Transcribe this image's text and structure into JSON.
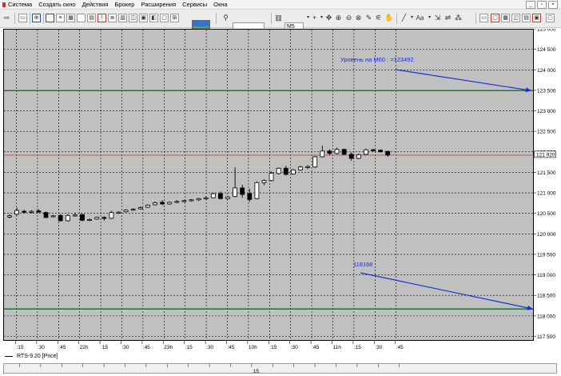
{
  "menu": {
    "items": [
      "Система",
      "Создать окно",
      "Действия",
      "Брокер",
      "Расширения",
      "Сервисы",
      "Окна"
    ]
  },
  "toolbar": {
    "timeframe": "M5",
    "icons": [
      "new-chart-icon",
      "open-icon",
      "save-icon",
      "print-icon",
      "logo-icon",
      "search-icon",
      "bar-chart-icon",
      "crosshair-icon",
      "zoom-in-icon",
      "zoom-out-icon",
      "pencil-icon",
      "hand-icon",
      "line-tool-icon",
      "text-tool-icon",
      "fibonacci-icon",
      "layout-icon",
      "windows-icon"
    ]
  },
  "chart_data": {
    "type": "candlestick",
    "symbol_label": "RTS-9.20 [Price]",
    "colors": {
      "background": "#c0c0c0",
      "grid": "#000000",
      "level_lines": "#1a7a2c",
      "last_price_line": "#e04040",
      "annotations": "#1c2fd6",
      "bull_candle": "#ffffff",
      "bear_candle": "#000000"
    },
    "price_axis": {
      "ylim": [
        117500,
        125000
      ],
      "ticks": [
        "125 000",
        "124 500",
        "124 000",
        "123 500",
        "123 000",
        "122 500",
        "122 000",
        "121 500",
        "121 000",
        "120 500",
        "120 000",
        "119 500",
        "119 000",
        "118 500",
        "118 000",
        "117 500"
      ],
      "tick_values": [
        125000,
        124500,
        124000,
        123500,
        123000,
        122500,
        122000,
        121500,
        121000,
        120500,
        120000,
        119500,
        119000,
        118500,
        118000,
        117500
      ],
      "last_price_label": "121 920",
      "last_price": 121920
    },
    "time_axis": {
      "labels": [
        ":15",
        ":30",
        ":45",
        "22h",
        ":15",
        ":30",
        ":45",
        "23h",
        ":15",
        ":30",
        ":45",
        "10h",
        ":15",
        ":30",
        ":45",
        "11h",
        ":15",
        ":30",
        ":45"
      ],
      "date_marker": "15"
    },
    "horizontal_levels": [
      {
        "name": "level-123492",
        "price": 123492
      },
      {
        "name": "level-118168",
        "price": 118168
      }
    ],
    "annotations": [
      {
        "label": "Уровень на М60 : =123492",
        "price": 123492
      },
      {
        "label": "118168",
        "price": 118168
      }
    ],
    "candles": [
      {
        "o": 120410,
        "h": 120480,
        "l": 120380,
        "c": 120440
      },
      {
        "o": 120480,
        "h": 120640,
        "l": 120450,
        "c": 120570
      },
      {
        "o": 120550,
        "h": 120590,
        "l": 120510,
        "c": 120530
      },
      {
        "o": 120540,
        "h": 120580,
        "l": 120500,
        "c": 120550
      },
      {
        "o": 120560,
        "h": 120600,
        "l": 120520,
        "c": 120530
      },
      {
        "o": 120520,
        "h": 120540,
        "l": 120380,
        "c": 120400
      },
      {
        "o": 120420,
        "h": 120460,
        "l": 120400,
        "c": 120440
      },
      {
        "o": 120450,
        "h": 120480,
        "l": 120300,
        "c": 120320
      },
      {
        "o": 120320,
        "h": 120480,
        "l": 120300,
        "c": 120450
      },
      {
        "o": 120450,
        "h": 120520,
        "l": 120420,
        "c": 120460
      },
      {
        "o": 120470,
        "h": 120490,
        "l": 120310,
        "c": 120330
      },
      {
        "o": 120330,
        "h": 120380,
        "l": 120310,
        "c": 120350
      },
      {
        "o": 120360,
        "h": 120420,
        "l": 120340,
        "c": 120400
      },
      {
        "o": 120400,
        "h": 120430,
        "l": 120320,
        "c": 120380
      },
      {
        "o": 120380,
        "h": 120560,
        "l": 120360,
        "c": 120520
      },
      {
        "o": 120510,
        "h": 120550,
        "l": 120490,
        "c": 120530
      },
      {
        "o": 120540,
        "h": 120600,
        "l": 120520,
        "c": 120580
      },
      {
        "o": 120580,
        "h": 120630,
        "l": 120560,
        "c": 120600
      },
      {
        "o": 120610,
        "h": 120670,
        "l": 120590,
        "c": 120640
      },
      {
        "o": 120650,
        "h": 120720,
        "l": 120630,
        "c": 120700
      },
      {
        "o": 120710,
        "h": 120790,
        "l": 120690,
        "c": 120760
      },
      {
        "o": 120770,
        "h": 120820,
        "l": 120700,
        "c": 120730
      },
      {
        "o": 120730,
        "h": 120790,
        "l": 120710,
        "c": 120770
      },
      {
        "o": 120770,
        "h": 120820,
        "l": 120750,
        "c": 120790
      },
      {
        "o": 120790,
        "h": 120830,
        "l": 120770,
        "c": 120810
      },
      {
        "o": 120810,
        "h": 120850,
        "l": 120790,
        "c": 120830
      },
      {
        "o": 120830,
        "h": 120880,
        "l": 120800,
        "c": 120860
      },
      {
        "o": 120860,
        "h": 120920,
        "l": 120840,
        "c": 120880
      },
      {
        "o": 120880,
        "h": 121000,
        "l": 120860,
        "c": 120980
      },
      {
        "o": 120980,
        "h": 121030,
        "l": 120840,
        "c": 120860
      },
      {
        "o": 120860,
        "h": 120920,
        "l": 120840,
        "c": 120900
      },
      {
        "o": 120910,
        "h": 121620,
        "l": 120890,
        "c": 121120
      },
      {
        "o": 121120,
        "h": 121200,
        "l": 120880,
        "c": 120960
      },
      {
        "o": 120980,
        "h": 121100,
        "l": 120780,
        "c": 120840
      },
      {
        "o": 120860,
        "h": 121280,
        "l": 120840,
        "c": 121250
      },
      {
        "o": 121250,
        "h": 121330,
        "l": 121190,
        "c": 121300
      },
      {
        "o": 121300,
        "h": 121520,
        "l": 121280,
        "c": 121480
      },
      {
        "o": 121470,
        "h": 121620,
        "l": 121450,
        "c": 121600
      },
      {
        "o": 121600,
        "h": 121660,
        "l": 121420,
        "c": 121450
      },
      {
        "o": 121460,
        "h": 121580,
        "l": 121440,
        "c": 121560
      },
      {
        "o": 121560,
        "h": 121660,
        "l": 121540,
        "c": 121630
      },
      {
        "o": 121620,
        "h": 121680,
        "l": 121580,
        "c": 121640
      },
      {
        "o": 121630,
        "h": 121900,
        "l": 121610,
        "c": 121880
      },
      {
        "o": 121880,
        "h": 122150,
        "l": 121860,
        "c": 122020
      },
      {
        "o": 122020,
        "h": 122060,
        "l": 121920,
        "c": 121960
      },
      {
        "o": 121960,
        "h": 122100,
        "l": 121940,
        "c": 122060
      },
      {
        "o": 122060,
        "h": 122080,
        "l": 121920,
        "c": 121940
      },
      {
        "o": 121940,
        "h": 121990,
        "l": 121780,
        "c": 121840
      },
      {
        "o": 121840,
        "h": 121960,
        "l": 121820,
        "c": 121930
      },
      {
        "o": 121940,
        "h": 122080,
        "l": 121920,
        "c": 122050
      },
      {
        "o": 122050,
        "h": 122080,
        "l": 122010,
        "c": 122030
      },
      {
        "o": 122040,
        "h": 122060,
        "l": 121980,
        "c": 122010
      },
      {
        "o": 122010,
        "h": 122030,
        "l": 121880,
        "c": 121920
      }
    ]
  },
  "legend": {
    "label": "RTS-9.20 [Price]"
  }
}
